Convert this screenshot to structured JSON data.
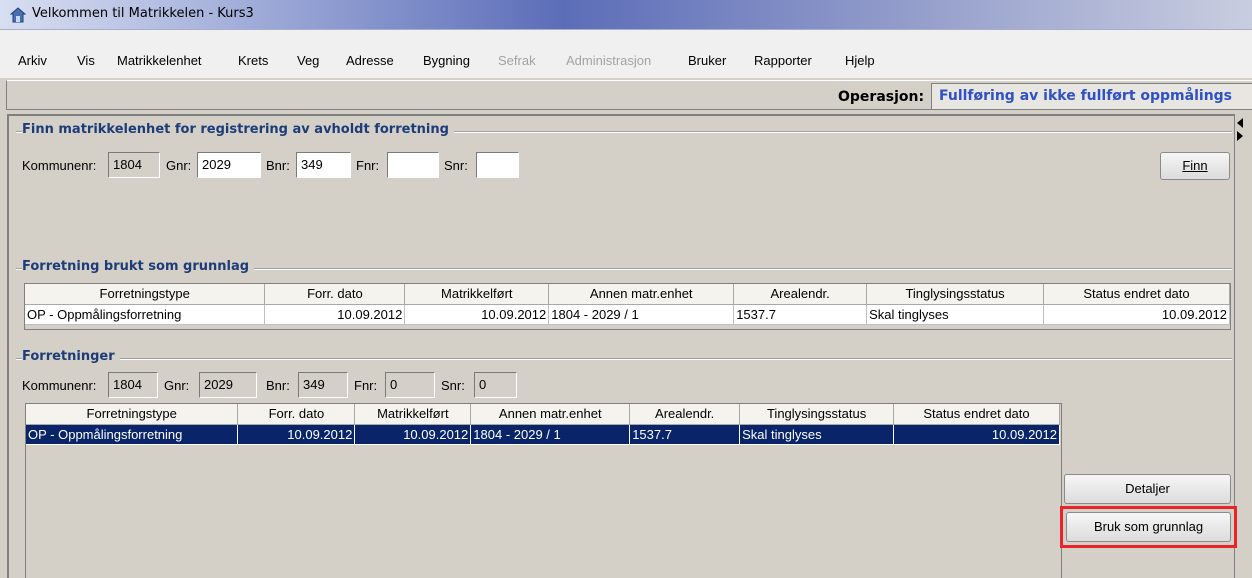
{
  "window": {
    "title": "Velkommen til Matrikkelen - Kurs3"
  },
  "menu": {
    "items": [
      {
        "label": "Arkiv",
        "disabled": false
      },
      {
        "label": "Vis",
        "disabled": false
      },
      {
        "label": "Matrikkelenhet",
        "disabled": false
      },
      {
        "label": "Krets",
        "disabled": false
      },
      {
        "label": "Veg",
        "disabled": false
      },
      {
        "label": "Adresse",
        "disabled": false
      },
      {
        "label": "Bygning",
        "disabled": false
      },
      {
        "label": "Sefrak",
        "disabled": true
      },
      {
        "label": "Administrasjon",
        "disabled": true
      },
      {
        "label": "Bruker",
        "disabled": false
      },
      {
        "label": "Rapporter",
        "disabled": false
      },
      {
        "label": "Hjelp",
        "disabled": false
      }
    ]
  },
  "operation": {
    "label": "Operasjon:",
    "value": "Fullføring av ikke fullført oppmålings"
  },
  "find_section": {
    "title": "Finn matrikkelenhet for registrering av avholdt forretning",
    "kommunenr_label": "Kommunenr:",
    "kommunenr": "1804",
    "gnr_label": "Gnr:",
    "gnr": "2029",
    "bnr_label": "Bnr:",
    "bnr": "349",
    "fnr_label": "Fnr:",
    "fnr": "",
    "snr_label": "Snr:",
    "snr": "",
    "find_button": "Finn"
  },
  "basis_section": {
    "title": "Forretning brukt som grunnlag",
    "columns": [
      "Forretningstype",
      "Forr. dato",
      "Matrikkelført",
      "Annen matr.enhet",
      "Arealendr.",
      "Tinglysingsstatus",
      "Status endret dato"
    ],
    "rows": [
      [
        "OP - Oppmålingsforretning",
        "10.09.2012",
        "10.09.2012",
        "1804 - 2029 / 1",
        "1537.7",
        "Skal tinglyses",
        "10.09.2012"
      ]
    ]
  },
  "business_section": {
    "title": "Forretninger",
    "kommunenr_label": "Kommunenr:",
    "kommunenr": "1804",
    "gnr_label": "Gnr:",
    "gnr": "2029",
    "bnr_label": "Bnr:",
    "bnr": "349",
    "fnr_label": "Fnr:",
    "fnr": "0",
    "snr_label": "Snr:",
    "snr": "0",
    "columns": [
      "Forretningstype",
      "Forr. dato",
      "Matrikkelført",
      "Annen matr.enhet",
      "Arealendr.",
      "Tinglysingsstatus",
      "Status endret dato"
    ],
    "rows": [
      [
        "OP - Oppmålingsforretning",
        "10.09.2012",
        "10.09.2012",
        "1804 - 2029 / 1",
        "1537.7",
        "Skal tinglyses",
        "10.09.2012"
      ]
    ],
    "details_button": "Detaljer",
    "use_as_basis_button": "Bruk som grunnlag"
  },
  "colors": {
    "group_title": "#1d3c78",
    "operation_value": "#3050c8",
    "selection": "#0a246a",
    "highlight_box": "#e8242a"
  }
}
